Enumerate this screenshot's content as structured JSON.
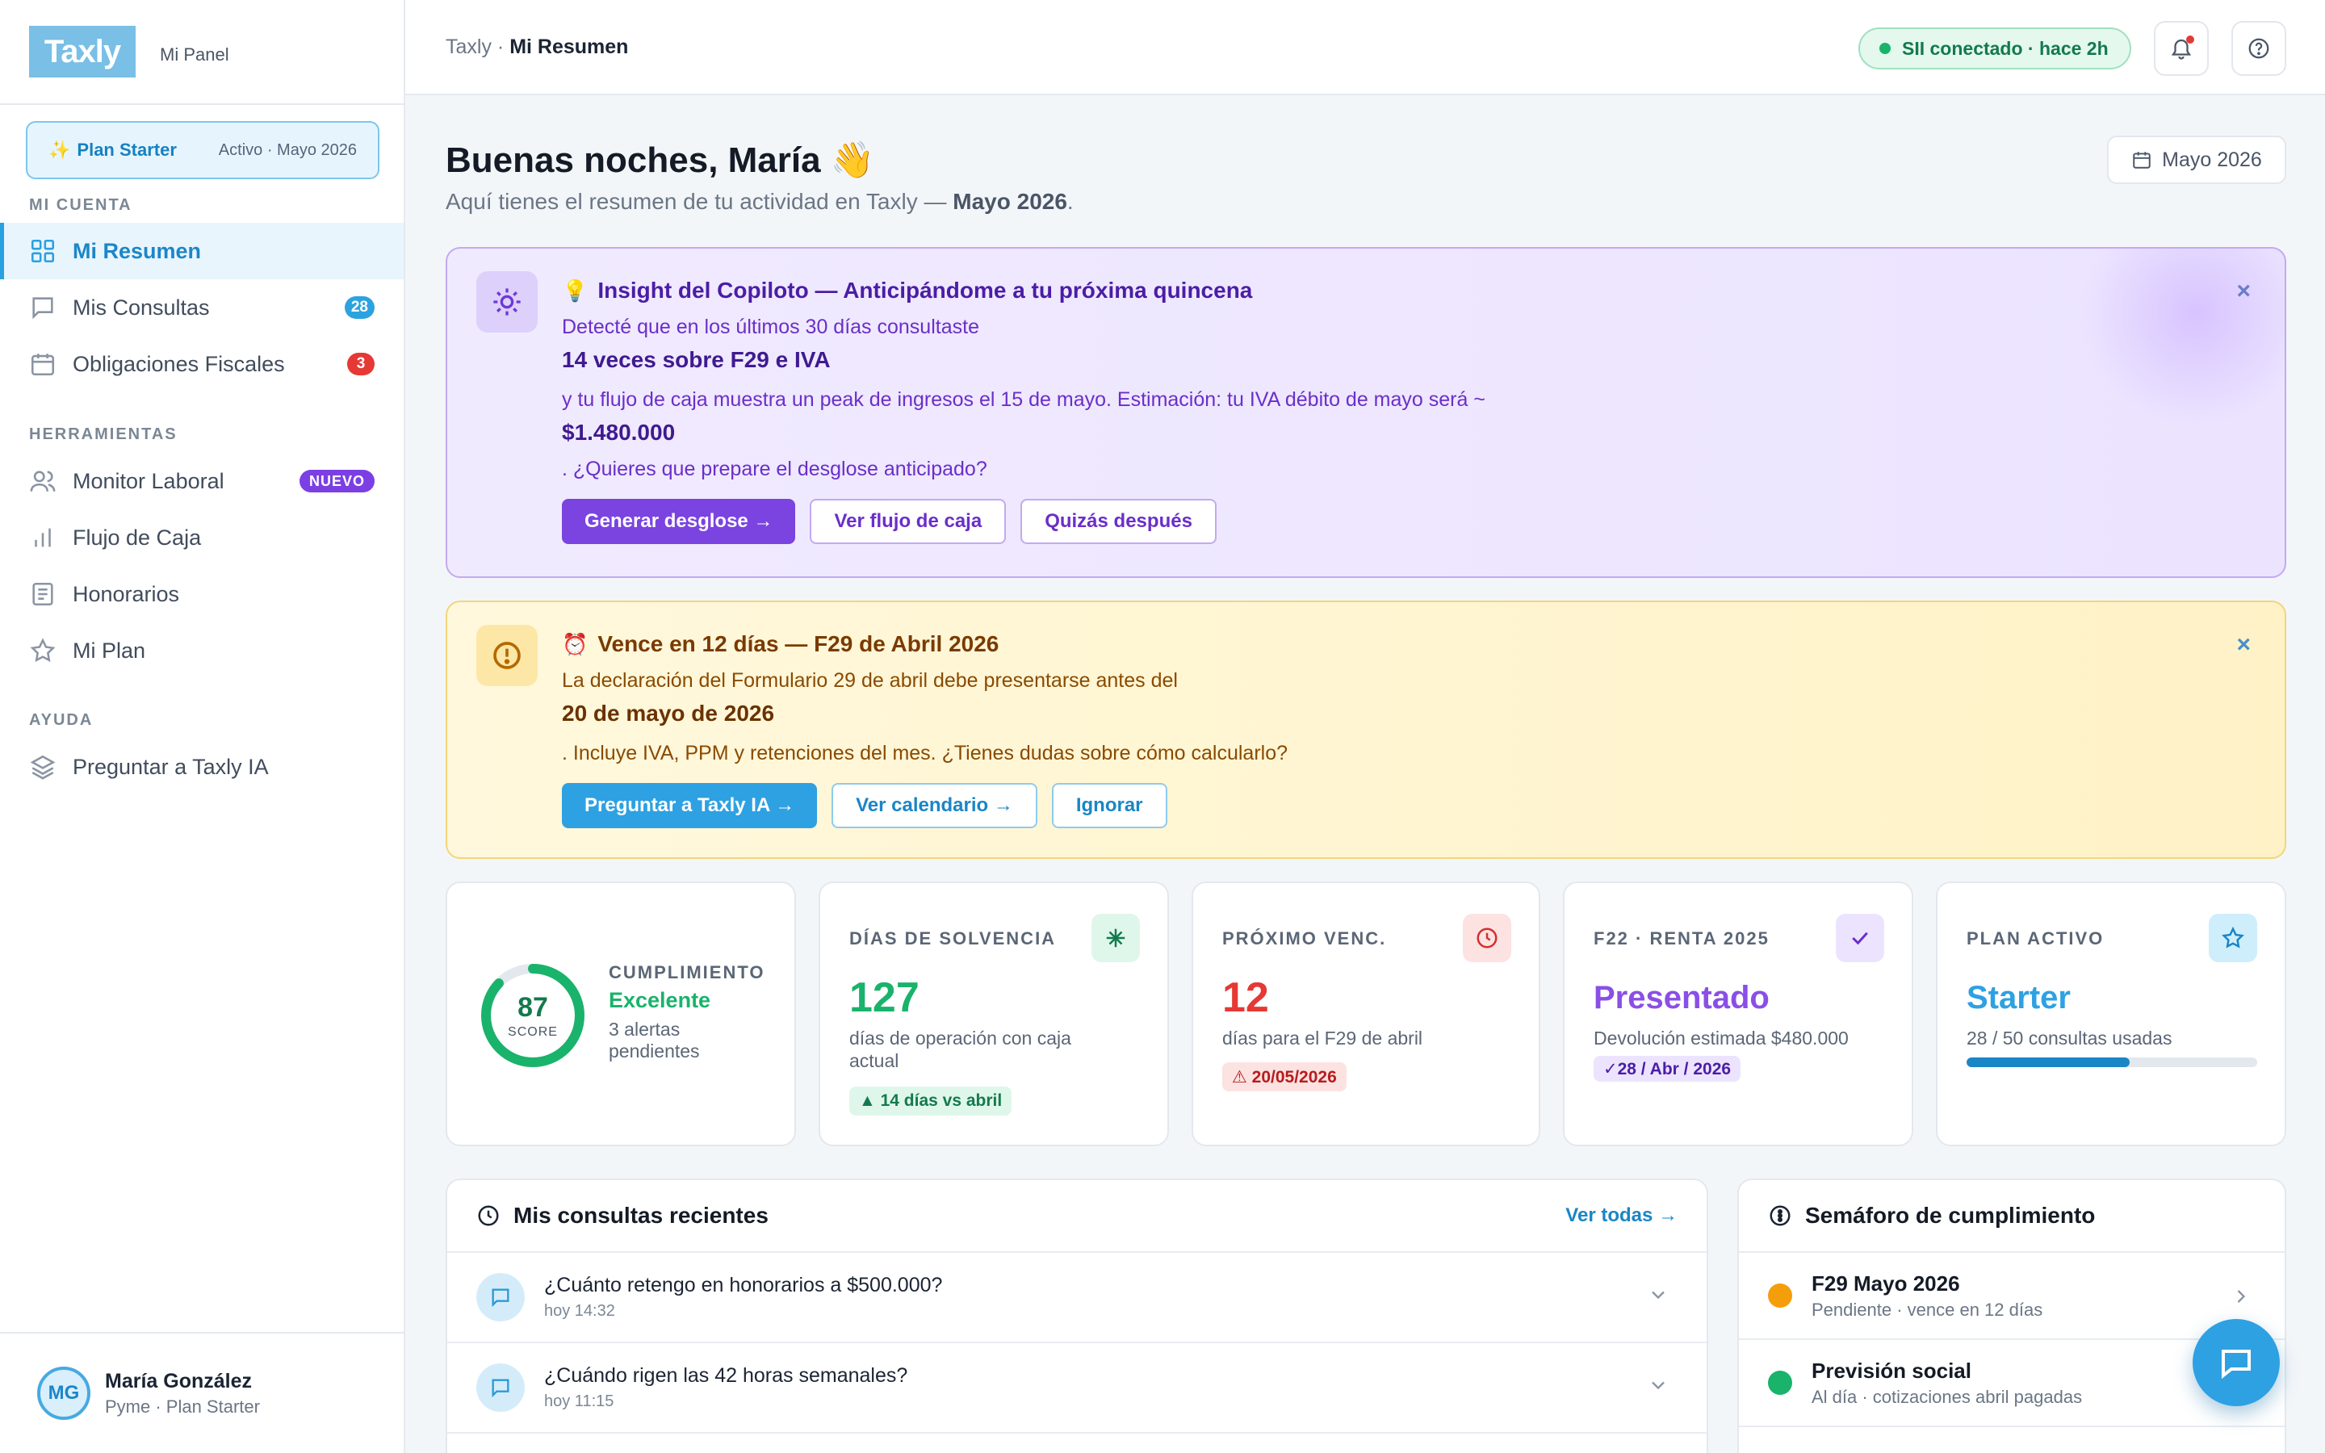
{
  "sidebar": {
    "logo": "Taxly",
    "panel_label": "Mi Panel",
    "plan": {
      "spark": "✨",
      "name": "Plan Starter",
      "status": "Activo · Mayo 2026"
    },
    "sections": {
      "account": "MI CUENTA",
      "tools": "HERRAMIENTAS",
      "help": "AYUDA"
    },
    "items": [
      {
        "label": "Mi Resumen",
        "icon": "grid-icon"
      },
      {
        "label": "Mis Consultas",
        "icon": "chat-icon",
        "badge": "28"
      },
      {
        "label": "Obligaciones Fiscales",
        "icon": "calendar-icon",
        "badge": "3"
      },
      {
        "label": "Monitor Laboral",
        "icon": "users-icon",
        "badge": "NUEVO"
      },
      {
        "label": "Flujo de Caja",
        "icon": "bar-chart-icon"
      },
      {
        "label": "Honorarios",
        "icon": "document-icon"
      },
      {
        "label": "Mi Plan",
        "icon": "star-icon"
      },
      {
        "label": "Preguntar a Taxly IA",
        "icon": "layers-icon"
      }
    ],
    "user": {
      "initials": "MG",
      "name": "María González",
      "role": "Pyme · Plan Starter"
    }
  },
  "header": {
    "breadcrumb_root": "Taxly",
    "breadcrumb_sep": " · ",
    "breadcrumb_current": "Mi Resumen",
    "sii_status": "SII conectado · hace 2h"
  },
  "main": {
    "greeting": "Buenas noches, María 👋",
    "sub_prefix": "Aquí tienes el resumen de tu actividad en Taxly — ",
    "sub_month": "Mayo 2026",
    "sub_suffix": ".",
    "date_button": "Mayo 2026"
  },
  "insight": {
    "emoji": "💡",
    "title": "Insight del Copiloto — Anticipándome a tu próxima quincena",
    "line1": "Detecté que en los últimos 30 días consultaste",
    "strong1": "14 veces sobre F29 e IVA",
    "line2": "y tu flujo de caja muestra un peak de ingresos el 15 de mayo. Estimación: tu IVA débito de mayo será ~",
    "strong2": "$1.480.000",
    "line3": ". ¿Quieres que prepare el desglose anticipado?",
    "actions": [
      "Generar desglose →",
      "Ver flujo de caja",
      "Quizás después"
    ],
    "close": "×"
  },
  "alert": {
    "emoji": "⏰",
    "title": "Vence en 12 días — F29 de Abril 2026",
    "line1": "La declaración del Formulario 29 de abril debe presentarse antes del",
    "strong1": "20 de mayo de 2026",
    "line2": ". Incluye IVA, PPM y retenciones del mes. ¿Tienes dudas sobre cómo calcularlo?",
    "actions": [
      "Preguntar a Taxly IA →",
      "Ver calendario →",
      "Ignorar"
    ],
    "close": "×"
  },
  "cards": {
    "compliance": {
      "score": "87",
      "score_label": "SCORE",
      "score_pct": 87,
      "label": "CUMPLIMIENTO",
      "value": "Excelente",
      "desc": "3 alertas pendientes"
    },
    "solvency": {
      "label": "DÍAS DE SOLVENCIA",
      "value": "127",
      "desc": "días de operación con caja actual",
      "chip": "▲ 14 días vs abril"
    },
    "next_due": {
      "label": "PRÓXIMO VENC.",
      "value": "12",
      "desc": "días para el F29 de abril",
      "chip": "⚠ 20/05/2026"
    },
    "f22": {
      "label": "F22 · RENTA 2025",
      "value": "Presentado",
      "desc": "Devolución estimada $480.000",
      "chip": "✓28 / Abr / 2026"
    },
    "plan": {
      "label": "PLAN ACTIVO",
      "value": "Starter",
      "desc": "28 / 50 consultas usadas",
      "used": 28,
      "total": 50
    }
  },
  "recent": {
    "title": "Mis consultas recientes",
    "link": "Ver todas →",
    "items": [
      {
        "question": "¿Cuánto retengo en honorarios a $500.000?",
        "time": "hoy 14:32"
      },
      {
        "question": "¿Cuándo rigen las 42 horas semanales?",
        "time": "hoy 11:15"
      }
    ]
  },
  "semaforo": {
    "title": "Semáforo de cumplimiento",
    "items": [
      {
        "title": "F29 Mayo 2026",
        "sub": "Pendiente · vence en 12 días",
        "color": "#f59e0b"
      },
      {
        "title": "Previsión social",
        "sub": "Al día · cotizaciones abril pagadas",
        "color": "#19b36b"
      }
    ]
  },
  "colors": {
    "accent": "#2ea1e2",
    "purple": "#7b43e0",
    "green": "#19b36b",
    "red": "#e53935"
  }
}
